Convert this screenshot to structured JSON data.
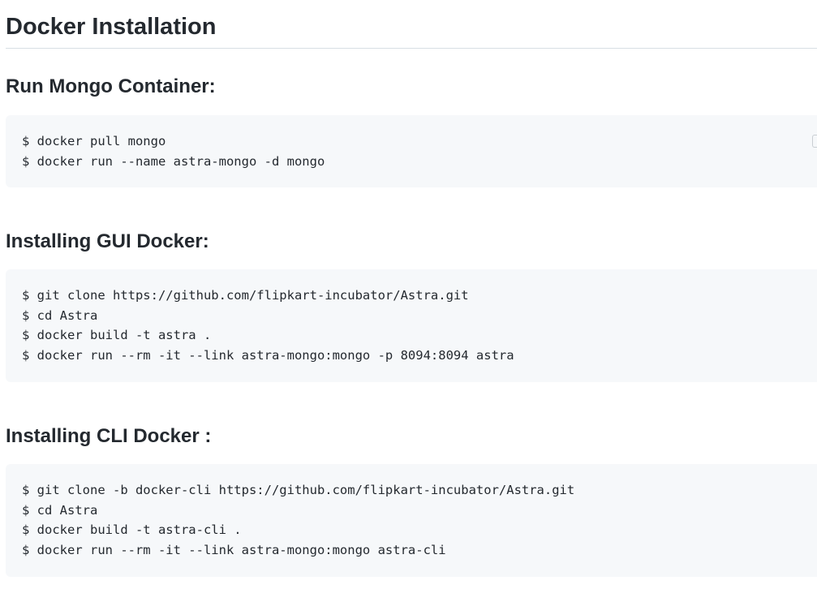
{
  "title": "Docker Installation",
  "sections": [
    {
      "heading": "Run Mongo Container:",
      "lines": [
        "$ docker pull mongo",
        "$ docker run --name astra-mongo -d mongo"
      ]
    },
    {
      "heading": "Installing GUI Docker:",
      "lines": [
        "$ git clone https://github.com/flipkart-incubator/Astra.git",
        "$ cd Astra",
        "$ docker build -t astra .",
        "$ docker run --rm -it --link astra-mongo:mongo -p 8094:8094 astra"
      ]
    },
    {
      "heading": "Installing CLI Docker :",
      "lines": [
        "$ git clone -b docker-cli https://github.com/flipkart-incubator/Astra.git",
        "$ cd Astra",
        "$ docker build -t astra-cli .",
        "$ docker run --rm -it --link astra-mongo:mongo astra-cli"
      ]
    }
  ],
  "icons": {
    "copy": "copy-icon"
  }
}
